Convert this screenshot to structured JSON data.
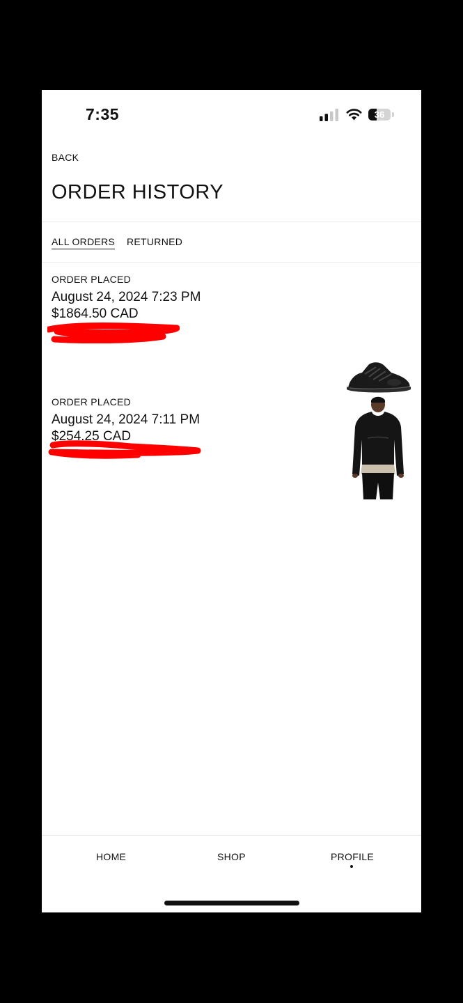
{
  "status_bar": {
    "time": "7:35",
    "battery": "36",
    "battery_level": 0.36
  },
  "header": {
    "back_label": "BACK",
    "title": "ORDER HISTORY"
  },
  "tabs": [
    {
      "label": "ALL ORDERS",
      "active": true
    },
    {
      "label": "RETURNED",
      "active": false
    }
  ],
  "orders": [
    {
      "label": "ORDER PLACED",
      "date": "August 24, 2024 7:23 PM",
      "total": "$1864.50 CAD",
      "order_number": "[redacted]",
      "product_image": "black-sneaker-icon"
    },
    {
      "label": "ORDER PLACED",
      "date": "August 24, 2024 7:11 PM",
      "total": "$254.25 CAD",
      "order_number": "[redacted]",
      "product_image": "black-hoodie-model-icon"
    }
  ],
  "bottom_nav": [
    {
      "label": "HOME",
      "active": false
    },
    {
      "label": "SHOP",
      "active": false
    },
    {
      "label": "PROFILE",
      "active": true
    }
  ],
  "colors": {
    "background": "#ffffff",
    "text": "#111111",
    "redaction": "#ff0000"
  }
}
